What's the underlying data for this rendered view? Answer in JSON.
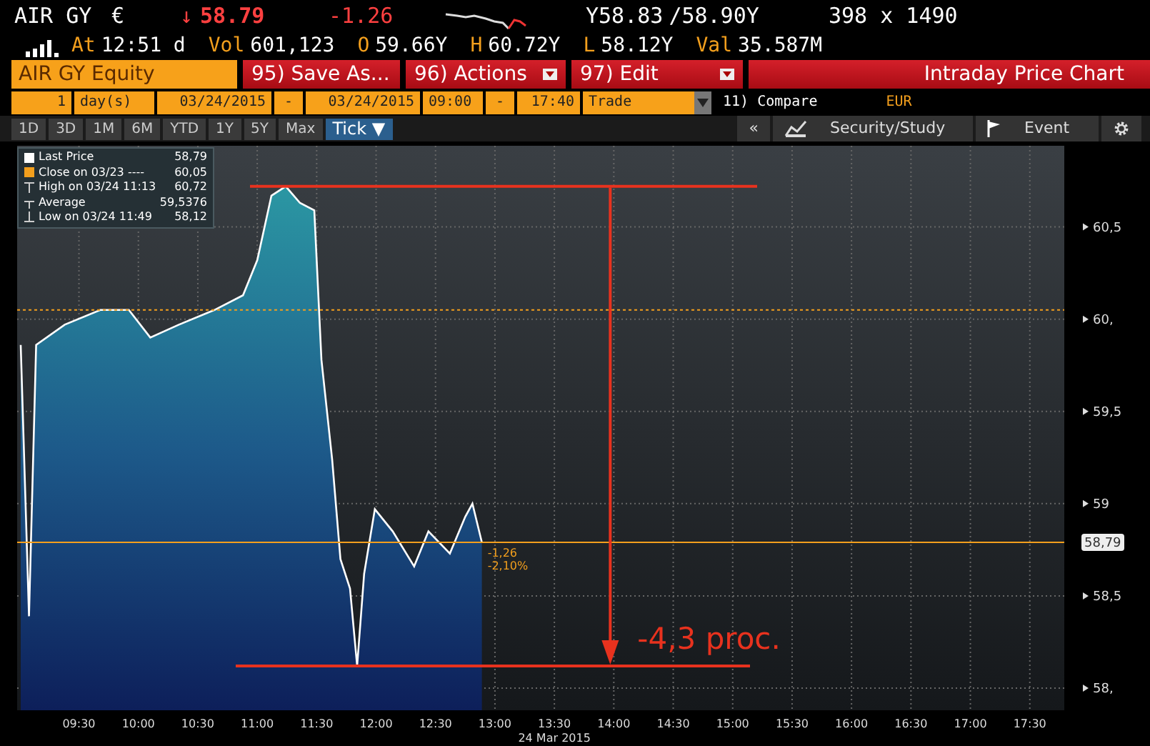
{
  "quote": {
    "ticker": "AIR GY",
    "currency": "€",
    "direction": "↓",
    "last": "58.79",
    "change": "-1.26",
    "bid": "Y58.83",
    "ask": "/58.90Y",
    "size": "398 x 1490"
  },
  "stats": [
    {
      "label": "At",
      "value": "12:51 d"
    },
    {
      "label": "Vol",
      "value": "601,123"
    },
    {
      "label": "O",
      "value": "59.66Y"
    },
    {
      "label": "H",
      "value": "60.72Y"
    },
    {
      "label": "L",
      "value": "58.12Y"
    },
    {
      "label": "Val",
      "value": "35.587M"
    }
  ],
  "title_bar": {
    "security": "AIR GY Equity",
    "buttons": [
      {
        "label": "95) Save As...",
        "dropdown": false
      },
      {
        "label": "96) Actions",
        "dropdown": true
      },
      {
        "label": "97) Edit",
        "dropdown": true
      }
    ],
    "title": "Intraday Price Chart"
  },
  "range_bar": {
    "count": "1",
    "unit": "day(s)",
    "start_date": "03/24/2015",
    "date_sep": "-",
    "end_date": "03/24/2015",
    "start_time": "09:00",
    "time_sep": "-",
    "end_time": "17:40",
    "event": "Trade",
    "compare": "11) Compare",
    "currency": "EUR"
  },
  "periods": [
    {
      "label": "1D",
      "selected": false
    },
    {
      "label": "3D",
      "selected": false
    },
    {
      "label": "1M",
      "selected": false
    },
    {
      "label": "6M",
      "selected": false
    },
    {
      "label": "YTD",
      "selected": false
    },
    {
      "label": "1Y",
      "selected": false
    },
    {
      "label": "5Y",
      "selected": false
    },
    {
      "label": "Max",
      "selected": false
    },
    {
      "label": "Tick ▼",
      "selected": true
    }
  ],
  "tools": {
    "collapse": "«",
    "study": "Security/Study",
    "event": "Event"
  },
  "legend": [
    {
      "kind": "swatch",
      "color": "#ffffff",
      "label": "Last Price",
      "value": "58,79"
    },
    {
      "kind": "swatch",
      "color": "#f39f1d",
      "label": "Close on 03/23 ----",
      "value": "60,05"
    },
    {
      "kind": "high",
      "label": "High on 03/24 11:13",
      "value": "60,72"
    },
    {
      "kind": "average",
      "label": "Average",
      "value": "59,5376"
    },
    {
      "kind": "low",
      "label": "Low on 03/24 11:49",
      "value": "58,12"
    }
  ],
  "last_price_tag": "58,79",
  "date_label": "24 Mar 2015",
  "chart_data": {
    "type": "area",
    "grid": true,
    "xlim": [
      8.98,
      17.79
    ],
    "ylim": [
      57.88,
      60.94
    ],
    "xticks": [
      {
        "value": 9.5,
        "label": "09:30"
      },
      {
        "value": 10,
        "label": "10:00"
      },
      {
        "value": 10.5,
        "label": "10:30"
      },
      {
        "value": 11,
        "label": "11:00"
      },
      {
        "value": 11.5,
        "label": "11:30"
      },
      {
        "value": 12,
        "label": "12:00"
      },
      {
        "value": 12.5,
        "label": "12:30"
      },
      {
        "value": 13,
        "label": "13:00"
      },
      {
        "value": 13.5,
        "label": "13:30"
      },
      {
        "value": 14,
        "label": "14:00"
      },
      {
        "value": 14.5,
        "label": "14:30"
      },
      {
        "value": 15,
        "label": "15:00"
      },
      {
        "value": 15.5,
        "label": "15:30"
      },
      {
        "value": 16,
        "label": "16:00"
      },
      {
        "value": 16.5,
        "label": "16:30"
      },
      {
        "value": 17,
        "label": "17:00"
      },
      {
        "value": 17.5,
        "label": "17:30"
      }
    ],
    "yticks": [
      {
        "value": 58,
        "label": "58,"
      },
      {
        "value": 58.5,
        "label": "58,5"
      },
      {
        "value": 59,
        "label": "59"
      },
      {
        "value": 59.5,
        "label": "59,5"
      },
      {
        "value": 60,
        "label": "60,"
      },
      {
        "value": 60.5,
        "label": "60,5"
      }
    ],
    "x": [
      9.01,
      9.08,
      9.14,
      9.38,
      9.68,
      9.92,
      10.1,
      10.34,
      10.64,
      10.88,
      11.0,
      11.12,
      11.24,
      11.36,
      11.48,
      11.54,
      11.63,
      11.7,
      11.78,
      11.84,
      11.9,
      11.99,
      12.14,
      12.32,
      12.44,
      12.62,
      12.75,
      12.81,
      12.89
    ],
    "series": [
      {
        "color": "#ffffff",
        "values": [
          59.86,
          58.39,
          59.86,
          59.97,
          60.05,
          60.05,
          59.9,
          59.97,
          60.05,
          60.13,
          60.32,
          60.67,
          60.72,
          60.63,
          60.59,
          59.78,
          59.24,
          58.7,
          58.54,
          58.12,
          58.62,
          58.97,
          58.85,
          58.66,
          58.85,
          58.73,
          58.93,
          59.0,
          58.79
        ]
      }
    ],
    "ref_lines": [
      {
        "axis": "y",
        "value": 60.05,
        "color": "#f39f1d"
      },
      {
        "axis": "y",
        "value": 58.79,
        "color": "#f39f1d"
      },
      {
        "axis": "y",
        "value": 60.72,
        "color": "#e8321e"
      },
      {
        "axis": "y",
        "value": 58.12,
        "color": "#e8321e"
      },
      {
        "axis": "x",
        "value": 13.97,
        "color": "#e8321e"
      }
    ],
    "annotations": [
      "-1,26",
      "-2,10%",
      "-4,3 proc."
    ]
  }
}
